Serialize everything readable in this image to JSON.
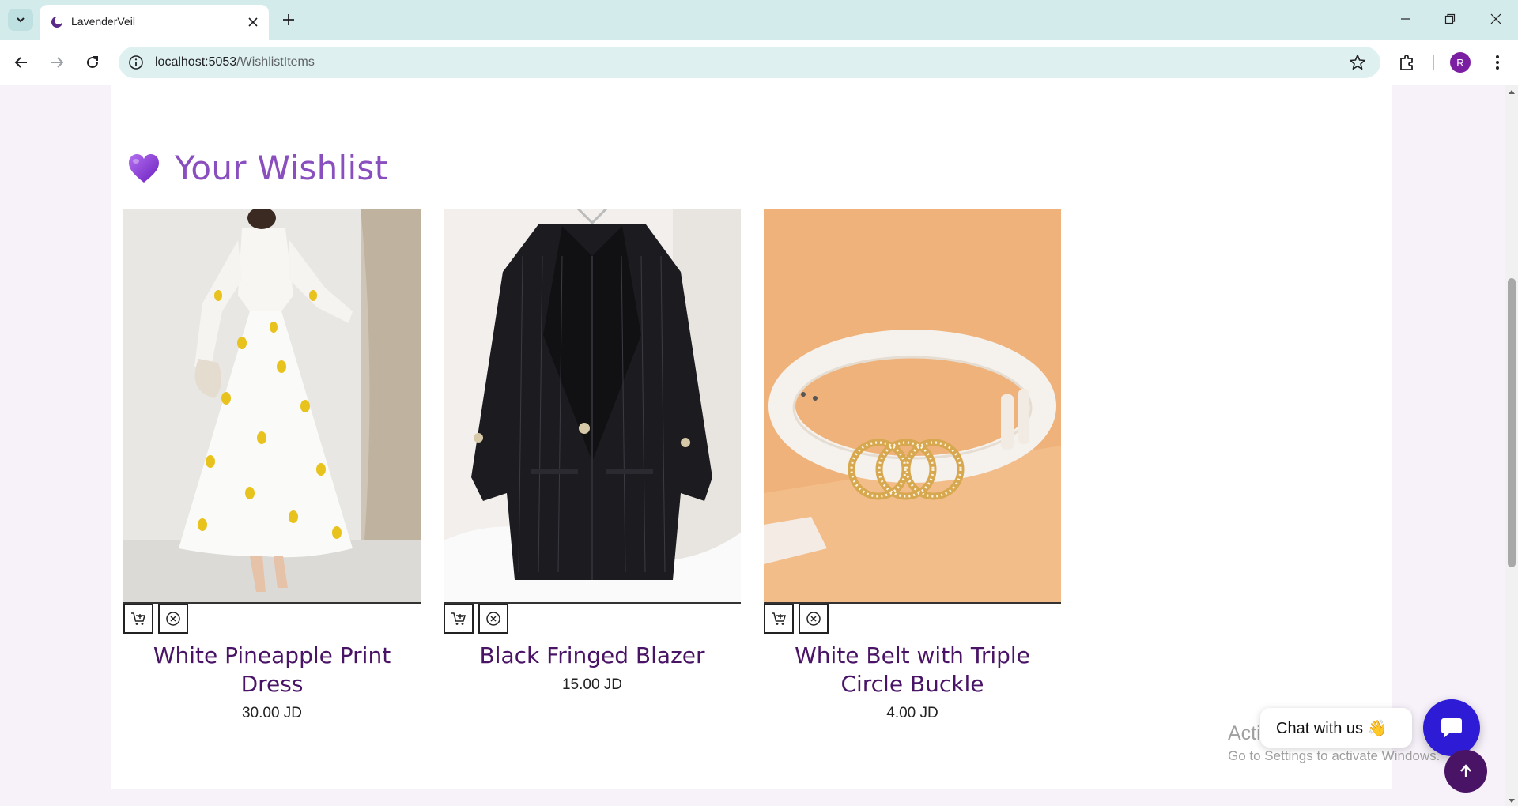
{
  "browser": {
    "tab_title": "LavenderVeil",
    "url_host": "localhost:5053",
    "url_path": "/WishlistItems",
    "profile_initial": "R"
  },
  "page": {
    "heading": "Your Wishlist",
    "items": [
      {
        "name": "White Pineapple Print Dress",
        "price": "30.00 JD",
        "image": "white-dress-photo"
      },
      {
        "name": "Black Fringed Blazer",
        "price": "15.00 JD",
        "image": "black-blazer-photo"
      },
      {
        "name": "White Belt with Triple Circle Buckle",
        "price": "4.00 JD",
        "image": "white-belt-photo"
      }
    ]
  },
  "chat": {
    "label": "Chat with us 👋"
  },
  "watermark": {
    "line1": "Activate Windows",
    "line2": "Go to Settings to activate Windows."
  },
  "colors": {
    "accent": "#8a4fbf",
    "product_title": "#4a1466",
    "chat_button": "#2d1bd6",
    "scroll_top": "#4a1466"
  }
}
